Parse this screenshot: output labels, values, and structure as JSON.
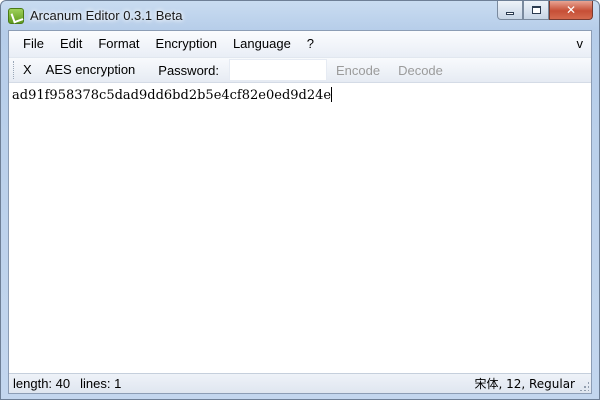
{
  "window": {
    "title": "Arcanum Editor 0.3.1 Beta",
    "icon": "app-logo-icon",
    "close_glyph": "✕"
  },
  "menu": {
    "items": [
      "File",
      "Edit",
      "Format",
      "Encryption",
      "Language",
      "?"
    ],
    "overflow": "v"
  },
  "toolbar": {
    "close_label": "X",
    "mode_label": "AES encryption",
    "password_label": "Password:",
    "password_value": "",
    "encode_label": "Encode",
    "decode_label": "Decode"
  },
  "editor": {
    "text": "ad91f958378c5dad9dd6bd2b5e4cf82e0ed9d24e"
  },
  "status": {
    "length": "length: 40",
    "lines": "lines: 1",
    "font": "宋体, 12, Regular"
  },
  "colors": {
    "title_gradient": "#b6cde9",
    "close_button": "#c64f36",
    "disabled_text": "#9b9b9b"
  }
}
